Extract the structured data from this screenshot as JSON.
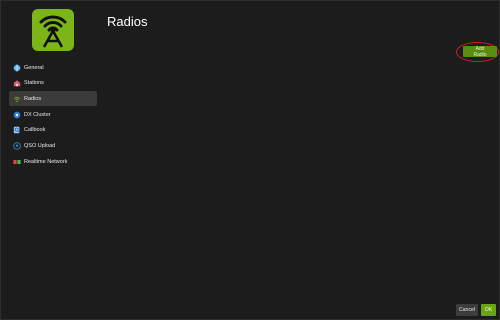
{
  "header": {
    "title": "Radios"
  },
  "logo": {
    "icon": "radio-tower-icon",
    "color": "#7cb518"
  },
  "sidebar": {
    "items": [
      {
        "label": "General",
        "icon": "globe-icon"
      },
      {
        "label": "Stations",
        "icon": "house-icon"
      },
      {
        "label": "Radios",
        "icon": "wifi-icon",
        "active": true
      },
      {
        "label": "DX Cluster",
        "icon": "network-icon"
      },
      {
        "label": "Callbook",
        "icon": "search-book-icon"
      },
      {
        "label": "QSO Upload",
        "icon": "upload-icon"
      },
      {
        "label": "Realtime Network",
        "icon": "realtime-network-icon"
      }
    ]
  },
  "actions": {
    "add_radio": "Add Radio"
  },
  "footer": {
    "cancel": "Cancel",
    "ok": "OK"
  },
  "colors": {
    "accent": "#7cb518",
    "button_green": "#5a8c12",
    "highlight_ring": "#d9182a"
  }
}
